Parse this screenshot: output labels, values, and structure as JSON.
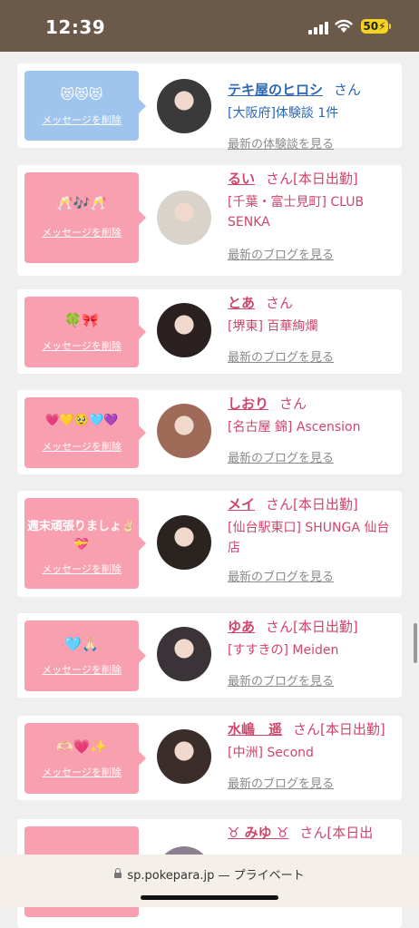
{
  "status": {
    "time": "12:39",
    "battery": "50"
  },
  "browser": {
    "url": "sp.pokepara.jp",
    "separator": " — ",
    "mode": "プライベート"
  },
  "delete_label": "メッセージを削除",
  "messages": [
    {
      "emoji": "😻😻😻",
      "bubble_color": "blue",
      "name": "テキ屋のヒロシ",
      "san": "さん",
      "status": "",
      "shop": "[大阪府]体験談 1件",
      "link": "最新の体験談を見る",
      "text_color": "blue"
    },
    {
      "emoji": "🥂🎶🥂",
      "bubble_color": "pink",
      "name": "るい",
      "san": "さん",
      "status": "[本日出勤]",
      "shop": "[千葉・富士見町] CLUB SENKA",
      "link": "最新のブログを見る",
      "text_color": "pink"
    },
    {
      "emoji": "🍀🎀",
      "bubble_color": "pink",
      "name": "とあ",
      "san": "さん",
      "status": "",
      "shop": "[堺東] 百華絢爛",
      "link": "最新のブログを見る",
      "text_color": "pink"
    },
    {
      "emoji": "💗💛🥹🩵💜",
      "bubble_color": "pink",
      "name": "しおり",
      "san": "さん",
      "status": "",
      "shop": "[名古屋 錦] Ascension",
      "link": "最新のブログを見る",
      "text_color": "pink"
    },
    {
      "emoji": "週末頑張りましょ✌🏻💝",
      "bubble_color": "pink",
      "name": "メイ",
      "san": "さん",
      "status": "[本日出勤]",
      "shop": "[仙台駅東口] SHUNGA 仙台店",
      "link": "最新のブログを見る",
      "text_color": "pink"
    },
    {
      "emoji": "🩵🙏🏻",
      "bubble_color": "pink",
      "name": "ゆあ",
      "san": "さん",
      "status": "[本日出勤]",
      "shop": "[すすきの] Meiden",
      "link": "最新のブログを見る",
      "text_color": "pink"
    },
    {
      "emoji": "🫶🏻💗✨",
      "bubble_color": "pink",
      "name": "水嶋　遥",
      "san": "さん",
      "status": "[本日出勤]",
      "shop": "[中洲] Second",
      "link": "最新のブログを見る",
      "text_color": "pink"
    },
    {
      "emoji": "",
      "bubble_color": "pink",
      "name": "♉ みゆ ♉",
      "san": "さん",
      "status": "[本日出",
      "shop": "",
      "link": "",
      "text_color": "pink"
    }
  ],
  "avatar_colors": [
    "#3a3a3a",
    "#d9d3cc",
    "#2a2020",
    "#a06a58",
    "#2b2320",
    "#3a3438",
    "#3b2d2a",
    "#8a8090"
  ]
}
